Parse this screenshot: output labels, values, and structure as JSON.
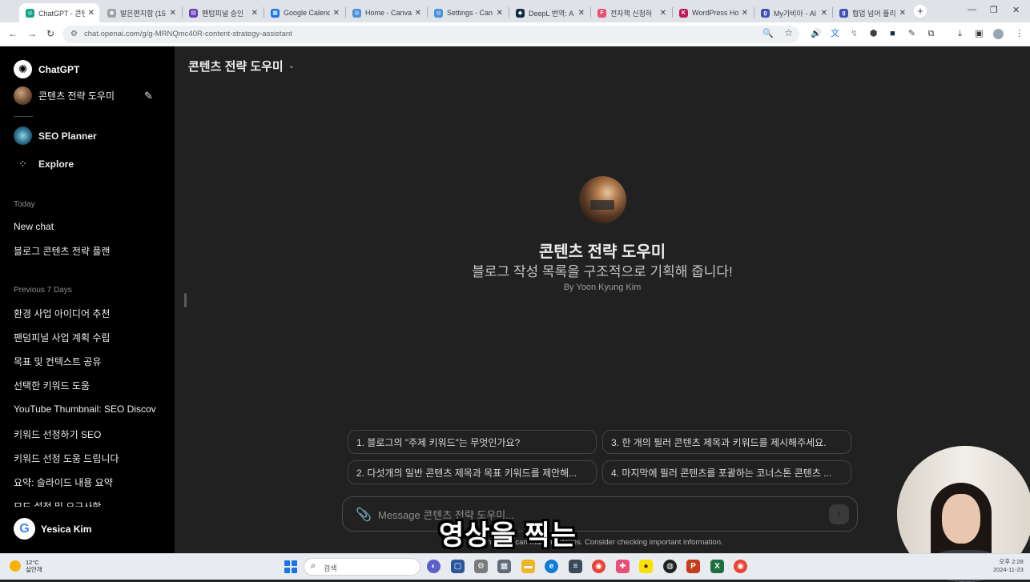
{
  "browser": {
    "tabs": [
      {
        "label": "ChatGPT - 콘텐",
        "color": "#10a37f",
        "glyph": "◎",
        "active": true
      },
      {
        "label": "발은편지함 (15",
        "color": "#9aa0a6",
        "glyph": "◉"
      },
      {
        "label": "팬텀피널 승인",
        "color": "#673ab7",
        "glyph": "▤"
      },
      {
        "label": "Google Calend",
        "color": "#1a73e8",
        "glyph": "▦"
      },
      {
        "label": "Home - Canva",
        "color": "#4a90d9",
        "glyph": "◎"
      },
      {
        "label": "Settings - Can",
        "color": "#4a90d9",
        "glyph": "◎"
      },
      {
        "label": "DeepL 번역: A",
        "color": "#0f2b46",
        "glyph": "◆"
      },
      {
        "label": "전자책 신청하",
        "color": "#e94e77",
        "glyph": "F"
      },
      {
        "label": "WordPress Ho",
        "color": "#c2185b",
        "glyph": "K"
      },
      {
        "label": "My가비아 - Al",
        "color": "#3f51b5",
        "glyph": "g"
      },
      {
        "label": "협업 넘어 플리",
        "color": "#3f51b5",
        "glyph": "g"
      }
    ],
    "tab_close": "✕",
    "new_tab": "+",
    "url": "chat.openai.com/g/g-MRNQmc40R-content-strategy-assistant",
    "window_controls": [
      "—",
      "❐",
      "✕"
    ]
  },
  "sidebar": {
    "app_name": "ChatGPT",
    "current_gpt": "콘텐츠 전략 도우미",
    "seo_gpt": "SEO Planner",
    "explore": "Explore",
    "today_label": "Today",
    "today_items": [
      "New chat",
      "블로그 콘텐츠 전략 플랜"
    ],
    "prev_label": "Previous 7 Days",
    "prev_items": [
      "환경 사업 아이디어 추천",
      "팬덤피널 사업 계획 수립",
      "목표 및 컨텍스트 공유",
      "선택한 키워드 도움",
      "YouTube Thumbnail: SEO Discove",
      "키워드 선정하기 SEO",
      "키워드 선정 도움 드립니다",
      "요약: 슬라이드 내용 요약",
      "모드 설정 및 요구사항"
    ],
    "user_name": "Yesica Kim"
  },
  "main": {
    "header_title": "콘텐츠 전략 도우미",
    "gpt_title": "콘텐츠 전략 도우미",
    "gpt_description": "블로그 작성 목록을 구조적으로 기획해 줍니다!",
    "gpt_author": "By Yoon Kyung Kim",
    "prompts": [
      "1. 블로그의 \"주제 키워드\"는 무엇인가요?",
      "3. 한 개의 필러 콘텐츠 제목과 키워드를 제시해주세요.",
      "2. 다섯개의 일반 콘텐츠 제목과 목표 키워드를 제안해...",
      "4. 마지막에 필러 콘텐츠를 포괄하는 코너스톤 콘텐츠 ..."
    ],
    "composer_placeholder": "Message 콘텐츠 전략 도우미...",
    "disclaimer": "ChatGPT can make mistakes. Consider checking important information.",
    "video_caption": "영상을 찍는"
  },
  "taskbar": {
    "weather_temp": "12°C",
    "weather_desc": "실안개",
    "search_placeholder": "검색",
    "time": "오후 2:28",
    "date": "2024-11-23"
  }
}
